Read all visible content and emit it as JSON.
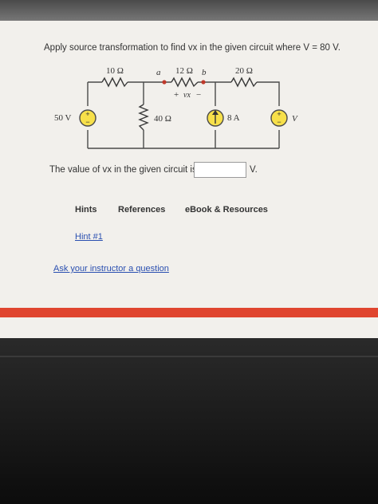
{
  "problem": {
    "text": "Apply source transformation to find vx in the given circuit where V = 80 V."
  },
  "circuit": {
    "r1": "10 Ω",
    "r2": "12 Ω",
    "r3": "20 Ω",
    "r4": "40 Ω",
    "node_a": "a",
    "node_b": "b",
    "vx_plus": "+",
    "vx_label": "vx",
    "vx_minus": "−",
    "source_v1": "50 V",
    "source_i": "8 A",
    "source_v2": "V"
  },
  "answer": {
    "prompt": "The value of vx in the given circuit is",
    "value": "",
    "unit": "V."
  },
  "tabs": {
    "hints": "Hints",
    "references": "References",
    "ebook": "eBook & Resources"
  },
  "links": {
    "hint1": "Hint #1",
    "ask": "Ask your instructor a question"
  },
  "colors": {
    "wire": "#4a4a4a",
    "source_fill": "#f7e04a",
    "node_dot": "#c0392b",
    "accent_bar": "#e0452f"
  }
}
